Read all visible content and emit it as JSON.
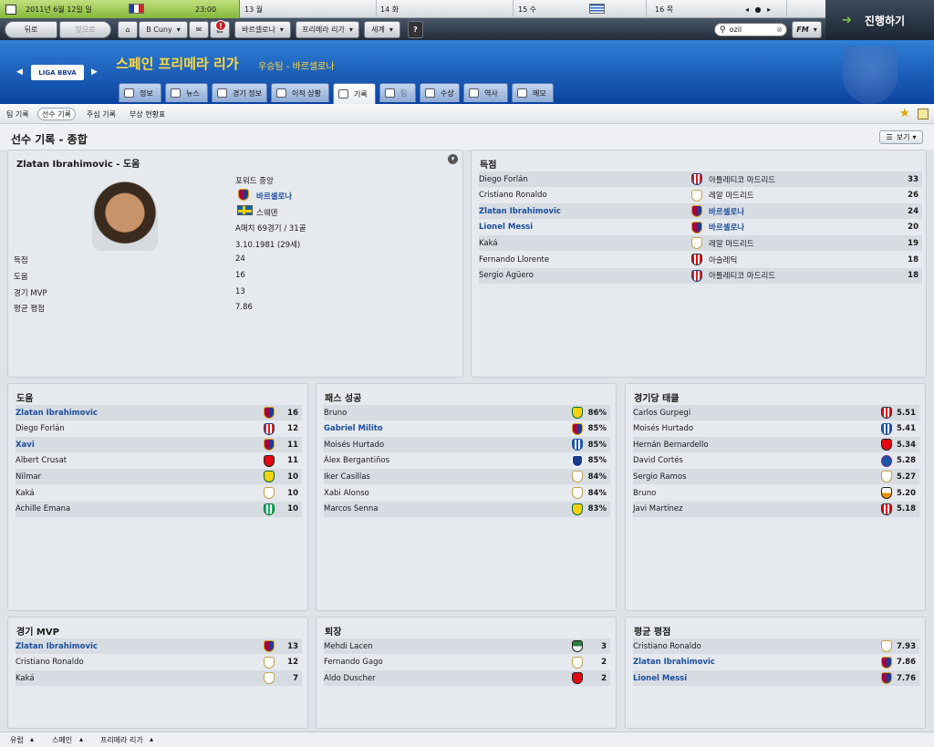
{
  "calendar": {
    "today_date": "2011년 6월 12일 일",
    "today_time": "23:00",
    "days": [
      "13 월",
      "14 화",
      "15 수",
      "16 목"
    ],
    "nav_dots": "◂ ● ▸"
  },
  "continue_label": "진행하기",
  "toolbar": {
    "back": "뒤로",
    "forward": "앞으로",
    "manager": "B Cuny",
    "badge": "!",
    "team": "바르셀로나",
    "league": "프리메라 리가",
    "world": "세계",
    "help": "?",
    "search_value": "ozil",
    "fm": "FM"
  },
  "header": {
    "competition": "스페인 프리메라 리가",
    "subtitle": "우승팀 - 바르셀로나",
    "logo_text": "LIGA BBVA"
  },
  "tabs": [
    {
      "label": "정보"
    },
    {
      "label": "뉴스"
    },
    {
      "label": "경기 정보"
    },
    {
      "label": "이적 상황"
    },
    {
      "label": "기록"
    },
    {
      "label": "팀"
    },
    {
      "label": "수상"
    },
    {
      "label": "역사"
    },
    {
      "label": "메모"
    }
  ],
  "subnav": [
    "팀 기록",
    "선수 기록",
    "주심 기록",
    "부상 현황표"
  ],
  "page_title": "선수 기록 - 종합",
  "view_label": "보기",
  "player": {
    "title": "Zlatan Ibrahimovic - 도움",
    "position": "포워드 중앙",
    "club": "바르셀로나",
    "nation": "스웨덴",
    "caps": "A매치 69경기 / 31골",
    "dob": "3.10.1981 (29세)",
    "stats": [
      {
        "label": "득점",
        "value": "24"
      },
      {
        "label": "도움",
        "value": "16"
      },
      {
        "label": "경기 MVP",
        "value": "13"
      },
      {
        "label": "평균 평점",
        "value": "7.86"
      }
    ]
  },
  "scorers": {
    "title": "득점",
    "rows": [
      {
        "name": "Diego Forlán",
        "club": "아틀레티코 마드리드",
        "value": "33",
        "crest": "atm",
        "link": false
      },
      {
        "name": "Cristiano Ronaldo",
        "club": "레알 마드리드",
        "value": "26",
        "crest": "real",
        "link": false
      },
      {
        "name": "Zlatan Ibrahimovic",
        "club": "바르셀로나",
        "value": "24",
        "crest": "barca",
        "link": true
      },
      {
        "name": "Lionel Messi",
        "club": "바르셀로나",
        "value": "20",
        "crest": "barca",
        "link": true
      },
      {
        "name": "Kaká",
        "club": "레알 마드리드",
        "value": "19",
        "crest": "real",
        "link": false
      },
      {
        "name": "Fernando Llorente",
        "club": "아슬레틱",
        "value": "18",
        "crest": "ath",
        "link": false
      },
      {
        "name": "Sergio Agüero",
        "club": "아틀레티코 마드리드",
        "value": "18",
        "crest": "atm",
        "link": false
      }
    ]
  },
  "assists": {
    "title": "도움",
    "rows": [
      {
        "name": "Zlatan Ibrahimovic",
        "value": "16",
        "crest": "barca",
        "link": true
      },
      {
        "name": "Diego Forlán",
        "value": "12",
        "crest": "atm",
        "link": false
      },
      {
        "name": "Xavi",
        "value": "11",
        "crest": "barca",
        "link": true
      },
      {
        "name": "Albert Crusat",
        "value": "11",
        "crest": "alm",
        "link": false
      },
      {
        "name": "Nilmar",
        "value": "10",
        "crest": "vill",
        "link": false
      },
      {
        "name": "Kaká",
        "value": "10",
        "crest": "real",
        "link": false
      },
      {
        "name": "Achille Emana",
        "value": "10",
        "crest": "betis",
        "link": false
      }
    ]
  },
  "passes": {
    "title": "패스 성공",
    "rows": [
      {
        "name": "Bruno",
        "value": "86%",
        "crest": "vill",
        "link": false
      },
      {
        "name": "Gabriel Milito",
        "value": "85%",
        "crest": "barca",
        "link": true
      },
      {
        "name": "Moisés Hurtado",
        "value": "85%",
        "crest": "esp",
        "link": false
      },
      {
        "name": "Álex Bergantiños",
        "value": "85%",
        "crest": "dep",
        "link": false
      },
      {
        "name": "Iker Casillas",
        "value": "84%",
        "crest": "real",
        "link": false
      },
      {
        "name": "Xabi Alonso",
        "value": "84%",
        "crest": "real",
        "link": false
      },
      {
        "name": "Marcos Senna",
        "value": "83%",
        "crest": "vill",
        "link": false
      }
    ]
  },
  "tackles": {
    "title": "경기당 태클",
    "rows": [
      {
        "name": "Carlos Gurpegi",
        "value": "5.51",
        "crest": "ath",
        "link": false
      },
      {
        "name": "Moisés Hurtado",
        "value": "5.41",
        "crest": "esp",
        "link": false
      },
      {
        "name": "Hernán Bernardello",
        "value": "5.34",
        "crest": "alm",
        "link": false
      },
      {
        "name": "David Cortés",
        "value": "5.28",
        "crest": "mal",
        "link": false
      },
      {
        "name": "Sergio Ramos",
        "value": "5.27",
        "crest": "real",
        "link": false
      },
      {
        "name": "Bruno",
        "value": "5.20",
        "crest": "val",
        "link": false
      },
      {
        "name": "Javi Martínez",
        "value": "5.18",
        "crest": "ath",
        "link": false
      }
    ]
  },
  "mvp": {
    "title": "경기 MVP",
    "rows": [
      {
        "name": "Zlatan Ibrahimovic",
        "value": "13",
        "crest": "barca",
        "link": true
      },
      {
        "name": "Cristiano Ronaldo",
        "value": "12",
        "crest": "real",
        "link": false
      },
      {
        "name": "Kaká",
        "value": "7",
        "crest": "real",
        "link": false
      }
    ]
  },
  "sendoffs": {
    "title": "퇴장",
    "rows": [
      {
        "name": "Mehdi Lacen",
        "value": "3",
        "crest": "rac2",
        "link": false
      },
      {
        "name": "Fernando Gago",
        "value": "2",
        "crest": "real",
        "link": false
      },
      {
        "name": "Aldo Duscher",
        "value": "2",
        "crest": "alm",
        "link": false
      }
    ]
  },
  "ratings": {
    "title": "평균 평점",
    "rows": [
      {
        "name": "Cristiano Ronaldo",
        "value": "7.93",
        "crest": "real",
        "link": false
      },
      {
        "name": "Zlatan Ibrahimovic",
        "value": "7.86",
        "crest": "barca",
        "link": true
      },
      {
        "name": "Lionel Messi",
        "value": "7.76",
        "crest": "barca",
        "link": true
      }
    ]
  },
  "footer": [
    "유럽",
    "스페인",
    "프리메라 리가"
  ]
}
